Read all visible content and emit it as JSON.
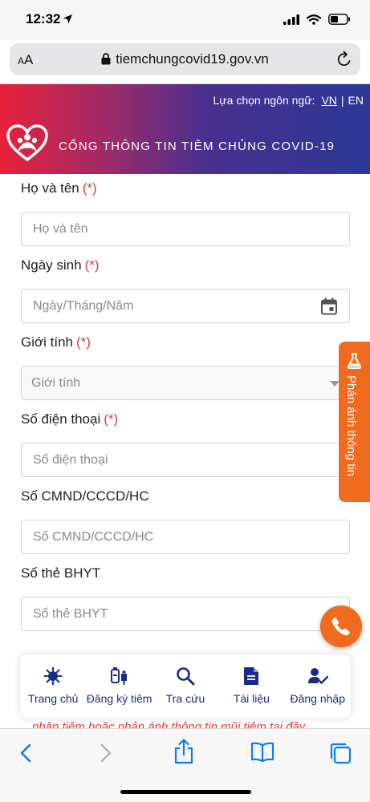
{
  "status_bar": {
    "time": "12:32"
  },
  "browser": {
    "aa_label_small": "A",
    "aa_label_big": "A",
    "url": "tiemchungcovid19.gov.vn"
  },
  "header": {
    "language_label": "Lựa chọn ngôn ngữ:",
    "lang_vn": "VN",
    "lang_sep": "|",
    "lang_en": "EN",
    "title": "CỔNG THÔNG TIN TIÊM CHỦNG COVID-19"
  },
  "form": {
    "required_mark": "(*)",
    "fullname": {
      "label": "Họ và tên",
      "placeholder": "Họ và tên"
    },
    "dob": {
      "label": "Ngày sinh",
      "placeholder": "Ngày/Tháng/Năm"
    },
    "gender": {
      "label": "Giới tính",
      "placeholder": "Giới tính"
    },
    "phone": {
      "label": "Số điện thoại",
      "placeholder": "Số điện thoại"
    },
    "id_number": {
      "label": "Số CMND/CCCD/HC",
      "placeholder": "Số CMND/CCCD/HC"
    },
    "insurance": {
      "label": "Số thẻ BHYT",
      "placeholder": "Số thẻ BHYT"
    }
  },
  "feedback_tab": {
    "label": "Phản ánh thông tin"
  },
  "bottom_nav": {
    "items": [
      {
        "label": "Trang chủ",
        "icon": "virus-icon"
      },
      {
        "label": "Đăng ký tiêm",
        "icon": "vaccine-icon"
      },
      {
        "label": "Tra cứu",
        "icon": "search-icon"
      },
      {
        "label": "Tài liệu",
        "icon": "document-icon"
      },
      {
        "label": "Đăng nhập",
        "icon": "user-check-icon"
      }
    ]
  },
  "partial_text": "nhận tiêm hoặc phản ánh thông tin mũi tiêm tại đây",
  "colors": {
    "accent": "#f06b1e",
    "nav_blue": "#1a2b8c",
    "required": "#e53935"
  }
}
